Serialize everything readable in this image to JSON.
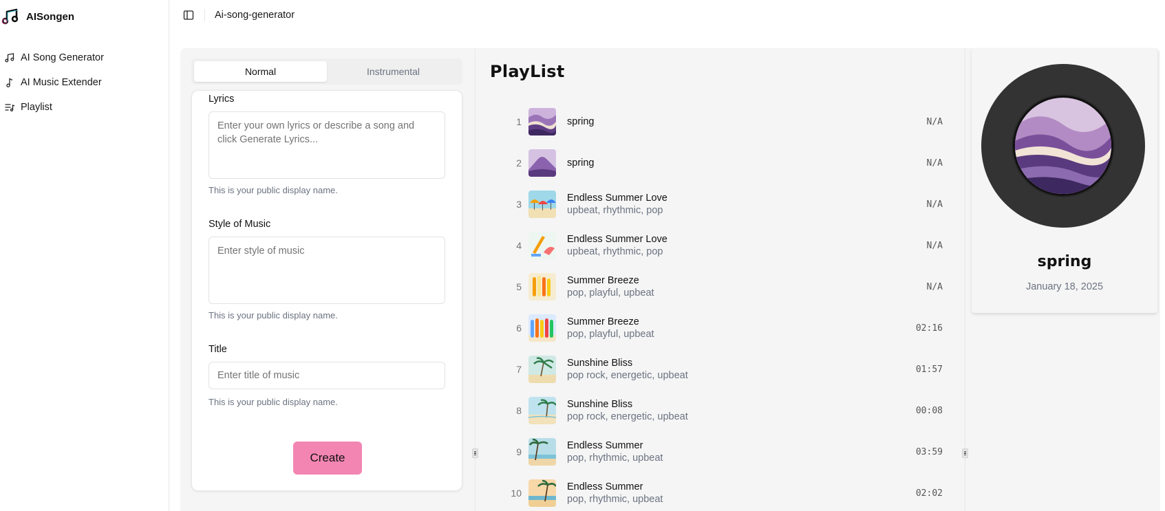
{
  "brand": {
    "name": "AISongen",
    "logo_icon": "music-notes-icon"
  },
  "sidebar": {
    "items": [
      {
        "label": "AI Song Generator",
        "icon": "music-note-icon"
      },
      {
        "label": "AI Music Extender",
        "icon": "single-note-icon"
      },
      {
        "label": "Playlist",
        "icon": "playlist-icon"
      }
    ]
  },
  "header": {
    "title": "Ai-song-generator",
    "toggle_icon": "sidebar-toggle-icon"
  },
  "form": {
    "tabs": [
      {
        "label": "Normal",
        "active": true
      },
      {
        "label": "Instrumental",
        "active": false
      }
    ],
    "lyrics": {
      "label": "Lyrics",
      "placeholder": "Enter your own lyrics or describe a song and click Generate Lyrics...",
      "value": "",
      "hint": "This is your public display name."
    },
    "style": {
      "label": "Style of Music",
      "placeholder": "Enter style of music",
      "value": "",
      "hint": "This is your public display name."
    },
    "title": {
      "label": "Title",
      "placeholder": "Enter title of music",
      "value": "",
      "hint": "This is your public display name."
    },
    "create_label": "Create",
    "create_color": "#f285b2"
  },
  "playlist": {
    "heading": "PlayList",
    "rows": [
      {
        "num": "1",
        "title": "spring",
        "tags": "",
        "duration": "N/A",
        "art": "purple-waves"
      },
      {
        "num": "2",
        "title": "spring",
        "tags": "",
        "duration": "N/A",
        "art": "purple-mountain"
      },
      {
        "num": "3",
        "title": "Endless Summer Love",
        "tags": "upbeat, rhythmic, pop",
        "duration": "N/A",
        "art": "beach-umbrellas"
      },
      {
        "num": "4",
        "title": "Endless Summer Love",
        "tags": "upbeat, rhythmic, pop",
        "duration": "N/A",
        "art": "beach-towels"
      },
      {
        "num": "5",
        "title": "Summer Breeze",
        "tags": "pop, playful, upbeat",
        "duration": "N/A",
        "art": "surfboards"
      },
      {
        "num": "6",
        "title": "Summer Breeze",
        "tags": "pop, playful, upbeat",
        "duration": "02:16",
        "art": "surfboards-row"
      },
      {
        "num": "7",
        "title": "Sunshine Bliss",
        "tags": "pop rock, energetic, upbeat",
        "duration": "01:57",
        "art": "palm-beach"
      },
      {
        "num": "8",
        "title": "Sunshine Bliss",
        "tags": "pop rock, energetic, upbeat",
        "duration": "00:08",
        "art": "palm-beach-2"
      },
      {
        "num": "9",
        "title": "Endless Summer",
        "tags": "pop, rhythmic, upbeat",
        "duration": "03:59",
        "art": "palm-sunset"
      },
      {
        "num": "10",
        "title": "Endless Summer",
        "tags": "pop, rhythmic, upbeat",
        "duration": "02:02",
        "art": "palm-sunset-2"
      }
    ]
  },
  "now_playing": {
    "title": "spring",
    "date": "January 18, 2025",
    "art": "purple-waves"
  }
}
